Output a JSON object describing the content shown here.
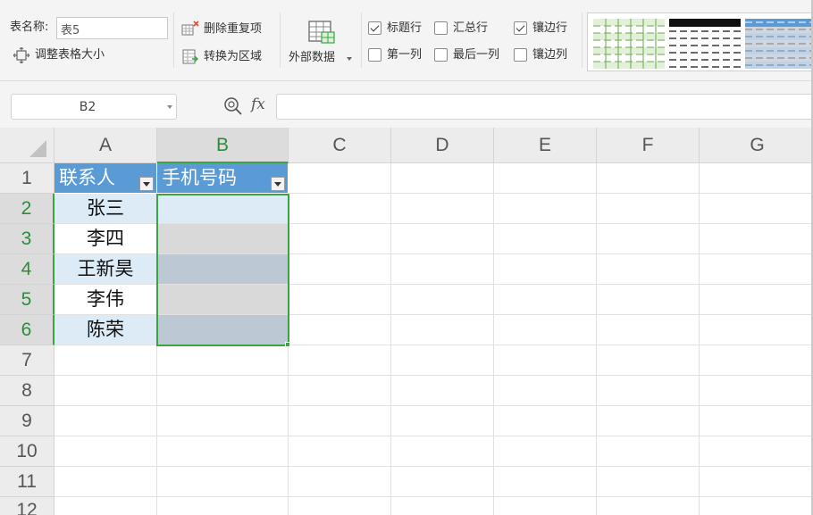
{
  "ribbon": {
    "table_name_label": "表名称:",
    "table_name_value": "表5",
    "resize_table_label": "调整表格大小",
    "remove_duplicates_label": "删除重复项",
    "convert_to_range_label": "转换为区域",
    "external_data_label": "外部数据",
    "options": {
      "header_row": {
        "label": "标题行",
        "checked": true
      },
      "total_row": {
        "label": "汇总行",
        "checked": false
      },
      "banded_rows": {
        "label": "镶边行",
        "checked": true
      },
      "first_column": {
        "label": "第一列",
        "checked": false
      },
      "last_column": {
        "label": "最后一列",
        "checked": false
      },
      "banded_columns": {
        "label": "镶边列",
        "checked": false
      }
    },
    "style_colors": [
      "#6aa84f",
      "#000000",
      "#5b9bd5"
    ]
  },
  "formula_bar": {
    "name_box": "B2",
    "fx_label": "fx",
    "formula": ""
  },
  "sheet": {
    "columns": [
      "A",
      "B",
      "C",
      "D",
      "E",
      "F",
      "G"
    ],
    "rows": [
      "1",
      "2",
      "3",
      "4",
      "5",
      "6",
      "7",
      "8",
      "9",
      "10",
      "11",
      "12"
    ],
    "selected_column": "B",
    "table": {
      "headers": [
        "联系人",
        "手机号码"
      ],
      "contacts": [
        "张三",
        "李四",
        "王新昊",
        "李伟",
        "陈荣"
      ],
      "phones": [
        "",
        "",
        "",
        "",
        ""
      ]
    },
    "colors": {
      "header_fill": "#5b9bd5",
      "band_light": "#ddebf7",
      "band_white": "#ffffff",
      "selected_fill_light": "#d9d9d9",
      "selected_fill_dark": "#bcc8d3",
      "selection_border": "#3aa345"
    }
  }
}
